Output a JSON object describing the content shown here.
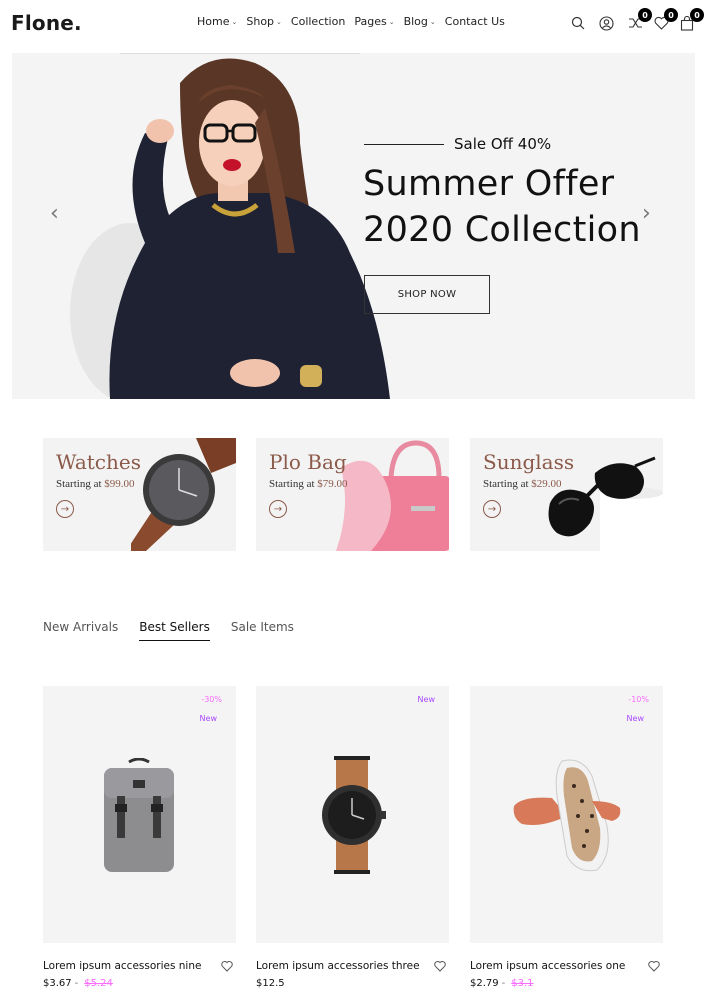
{
  "header": {
    "logo": "Flone.",
    "nav": [
      {
        "label": "Home",
        "dropdown": true
      },
      {
        "label": "Shop",
        "dropdown": true
      },
      {
        "label": "Collection",
        "dropdown": false
      },
      {
        "label": "Pages",
        "dropdown": true
      },
      {
        "label": "Blog",
        "dropdown": true
      },
      {
        "label": "Contact Us",
        "dropdown": false
      }
    ],
    "icons": [
      "search-icon",
      "account-icon",
      "compare-icon",
      "wishlist-icon",
      "cart-icon"
    ],
    "compare_count": "0",
    "wishlist_count": "0",
    "cart_count": "0"
  },
  "hero": {
    "sale_text": "Sale Off 40%",
    "title_line1": "Summer Offer",
    "title_line2": "2020 Collection",
    "button": "SHOP NOW",
    "prev": "‹",
    "next": "›"
  },
  "banners": [
    {
      "title": "Watches",
      "starting": "Starting at",
      "price": "$99.00"
    },
    {
      "title": "Plo Bag",
      "starting": "Starting at",
      "price": "$79.00"
    },
    {
      "title": "Sunglass",
      "starting": "Starting at",
      "price": "$29.00"
    }
  ],
  "tabs": [
    "New Arrivals",
    "Best Sellers",
    "Sale Items"
  ],
  "active_tab": "Best Sellers",
  "products": [
    {
      "name": "Lorem ipsum accessories nine",
      "price": "$3.67",
      "old_price": "$5.24",
      "discount": "-30%",
      "new": "New"
    },
    {
      "name": "Lorem ipsum accessories three",
      "price": "$12.5",
      "old_price": "",
      "discount": "",
      "new": "New"
    },
    {
      "name": "Lorem ipsum accessories one",
      "price": "$2.79",
      "old_price": "$3.1",
      "discount": "-10%",
      "new": "New"
    }
  ],
  "colors": {
    "accent_pink": "#fa6bff",
    "accent_purple": "#a749ff",
    "banner_brown": "#8b5a4a"
  }
}
